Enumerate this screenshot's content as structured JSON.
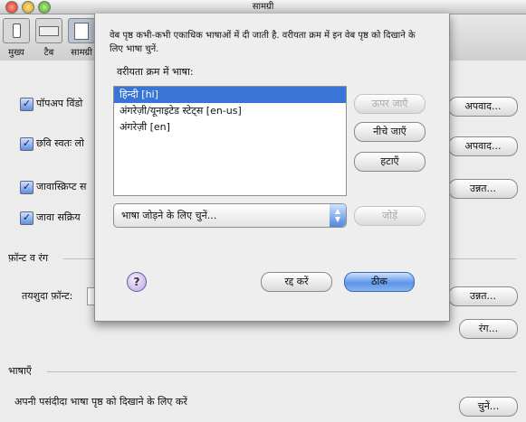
{
  "window": {
    "title": "सामग्री"
  },
  "toolbar": {
    "items": [
      {
        "label": "मुख्य"
      },
      {
        "label": "टैब"
      },
      {
        "label": "सामग्री"
      }
    ]
  },
  "prefs": {
    "popup_label": "पॉपअप विंडो",
    "images_label": "छवि स्वतः लो",
    "javascript_label": "जावास्क्रिप्ट स",
    "java_label": "जावा सक्रिय",
    "exceptions_btn": "अपवाद...",
    "exceptions_btn2": "अपवाद...",
    "advanced_btn": "उन्नत...",
    "fonts_section": "फ़ॉन्ट व रंग",
    "default_font_label": "तयशुदा फ़ॉन्ट:",
    "advanced_btn2": "उन्नत...",
    "colors_btn": "रंग...",
    "languages_section": "भाषाएँ",
    "languages_desc": "अपनी पसंदीदा भाषा पृष्ठ को दिखाने के लिए करें",
    "choose_btn": "चुनें..."
  },
  "sheet": {
    "description": "वेब पृष्ठ कभी-कभी एकाधिक भाषाओं में दी जाती है. वरीयता क्रम में इन वेब पृष्ठ को दिखाने के लिए भाषा चुनें.",
    "list_heading": "वरीयता क्रम में भाषा:",
    "languages": [
      {
        "label": "हिन्दी  [hi]",
        "selected": true
      },
      {
        "label": "अंगरेज़ी/यूनाइटेड स्टेट्स  [en-us]",
        "selected": false
      },
      {
        "label": "अंगरेज़ी  [en]",
        "selected": false
      }
    ],
    "move_up_btn": "ऊपर जाएँ",
    "move_down_btn": "नीचे जाएँ",
    "remove_btn": "हटाएँ",
    "add_popup_value": "भाषा जोड़ने के लिए चुनें...",
    "add_btn": "जोड़ें",
    "help_glyph": "?",
    "cancel_btn": "रद्द करें",
    "ok_btn": "ठीक"
  }
}
